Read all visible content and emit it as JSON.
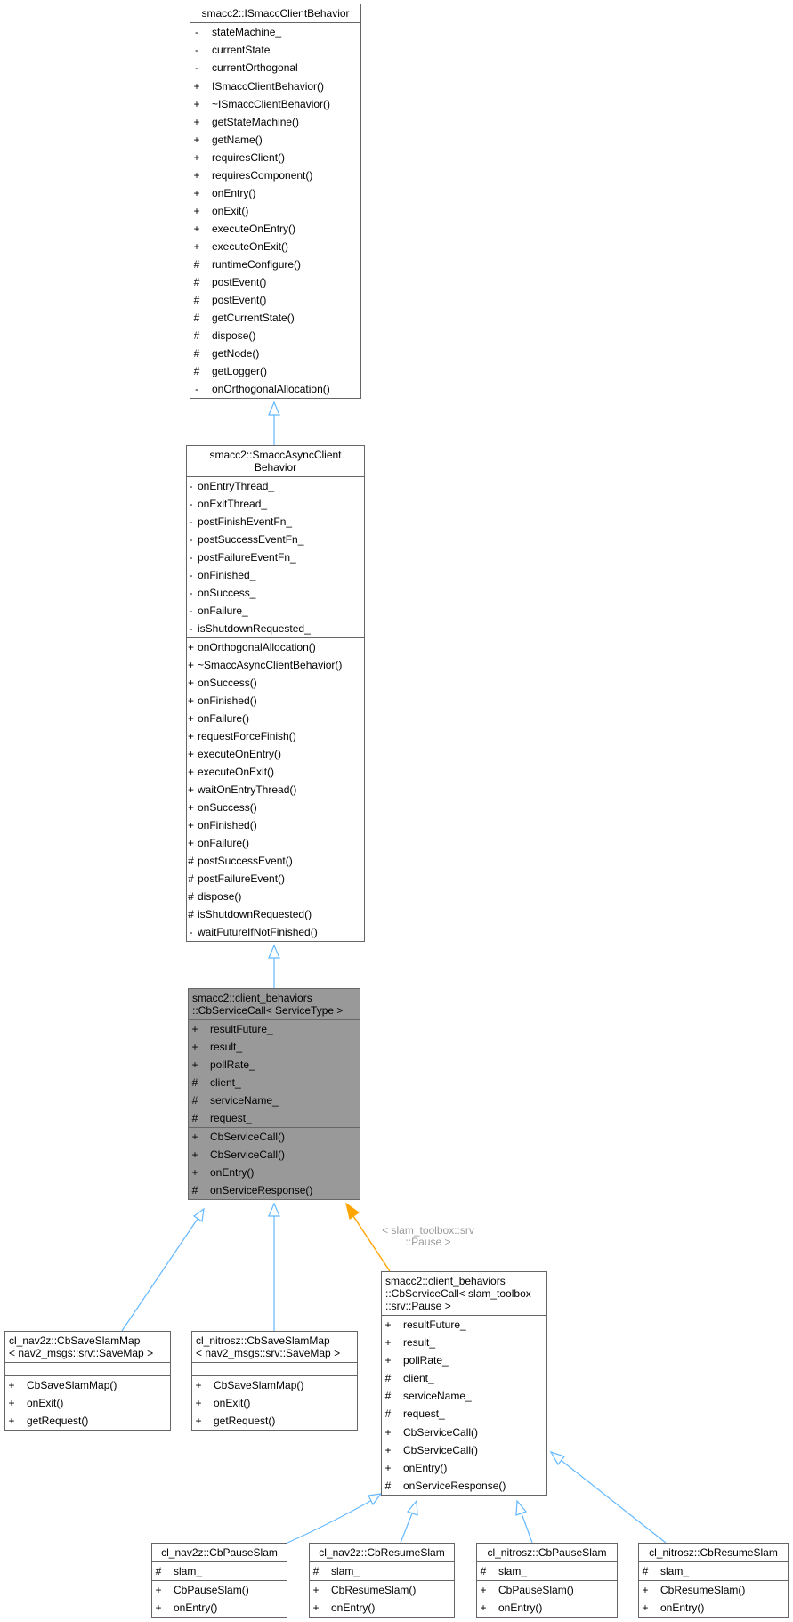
{
  "colors": {
    "inherit_edge": "#63b8ff",
    "template_edge": "#ffa500",
    "focus_fill": "#999999",
    "border": "#666666"
  },
  "template_edge_label": [
    "< slam_toolbox::srv",
    "::Pause >"
  ],
  "classes": {
    "isc": {
      "title": [
        "smacc2::ISmaccClientBehavior"
      ],
      "attributes": [
        {
          "v": "-",
          "n": "stateMachine_"
        },
        {
          "v": "-",
          "n": "currentState"
        },
        {
          "v": "-",
          "n": "currentOrthogonal"
        }
      ],
      "methods": [
        {
          "v": "+",
          "n": "ISmaccClientBehavior()"
        },
        {
          "v": "+",
          "n": "~ISmaccClientBehavior()"
        },
        {
          "v": "+",
          "n": "getStateMachine()"
        },
        {
          "v": "+",
          "n": "getName()"
        },
        {
          "v": "+",
          "n": "requiresClient()"
        },
        {
          "v": "+",
          "n": "requiresComponent()"
        },
        {
          "v": "+",
          "n": "onEntry()"
        },
        {
          "v": "+",
          "n": "onExit()"
        },
        {
          "v": "+",
          "n": "executeOnEntry()"
        },
        {
          "v": "+",
          "n": "executeOnExit()"
        },
        {
          "v": "#",
          "n": "runtimeConfigure()"
        },
        {
          "v": "#",
          "n": "postEvent()"
        },
        {
          "v": "#",
          "n": "postEvent()"
        },
        {
          "v": "#",
          "n": "getCurrentState()"
        },
        {
          "v": "#",
          "n": "dispose()"
        },
        {
          "v": "#",
          "n": "getNode()"
        },
        {
          "v": "#",
          "n": "getLogger()"
        },
        {
          "v": "-",
          "n": "onOrthogonalAllocation()"
        }
      ]
    },
    "sacb": {
      "title": [
        "smacc2::SmaccAsyncClient",
        "Behavior"
      ],
      "attributes": [
        {
          "v": "-",
          "n": "onEntryThread_"
        },
        {
          "v": "-",
          "n": "onExitThread_"
        },
        {
          "v": "-",
          "n": "postFinishEventFn_"
        },
        {
          "v": "-",
          "n": "postSuccessEventFn_"
        },
        {
          "v": "-",
          "n": "postFailureEventFn_"
        },
        {
          "v": "-",
          "n": "onFinished_"
        },
        {
          "v": "-",
          "n": "onSuccess_"
        },
        {
          "v": "-",
          "n": "onFailure_"
        },
        {
          "v": "-",
          "n": "isShutdownRequested_"
        }
      ],
      "methods": [
        {
          "v": "+",
          "n": "onOrthogonalAllocation()"
        },
        {
          "v": "+",
          "n": "~SmaccAsyncClientBehavior()"
        },
        {
          "v": "+",
          "n": "onSuccess()"
        },
        {
          "v": "+",
          "n": "onFinished()"
        },
        {
          "v": "+",
          "n": "onFailure()"
        },
        {
          "v": "+",
          "n": "requestForceFinish()"
        },
        {
          "v": "+",
          "n": "executeOnEntry()"
        },
        {
          "v": "+",
          "n": "executeOnExit()"
        },
        {
          "v": "+",
          "n": "waitOnEntryThread()"
        },
        {
          "v": "+",
          "n": "onSuccess()"
        },
        {
          "v": "+",
          "n": "onFinished()"
        },
        {
          "v": "+",
          "n": "onFailure()"
        },
        {
          "v": "#",
          "n": "postSuccessEvent()"
        },
        {
          "v": "#",
          "n": "postFailureEvent()"
        },
        {
          "v": "#",
          "n": "dispose()"
        },
        {
          "v": "#",
          "n": "isShutdownRequested()"
        },
        {
          "v": "-",
          "n": "waitFutureIfNotFinished()"
        }
      ]
    },
    "cbsc": {
      "title": [
        "smacc2::client_behaviors",
        "::CbServiceCall< ServiceType >"
      ],
      "attributes": [
        {
          "v": "+",
          "n": "resultFuture_"
        },
        {
          "v": "+",
          "n": "result_"
        },
        {
          "v": "+",
          "n": "pollRate_"
        },
        {
          "v": "#",
          "n": "client_"
        },
        {
          "v": "#",
          "n": "serviceName_"
        },
        {
          "v": "#",
          "n": "request_"
        }
      ],
      "methods": [
        {
          "v": "+",
          "n": "CbServiceCall()"
        },
        {
          "v": "+",
          "n": "CbServiceCall()"
        },
        {
          "v": "+",
          "n": "onEntry()"
        },
        {
          "v": "#",
          "n": "onServiceResponse()"
        }
      ]
    },
    "nav2save": {
      "title": [
        "cl_nav2z::CbSaveSlamMap",
        "< nav2_msgs::srv::SaveMap >"
      ],
      "attributes": [],
      "methods": [
        {
          "v": "+",
          "n": "CbSaveSlamMap()"
        },
        {
          "v": "+",
          "n": "onExit()"
        },
        {
          "v": "+",
          "n": "getRequest()"
        }
      ]
    },
    "nitrosave": {
      "title": [
        "cl_nitrosz::CbSaveSlamMap",
        "< nav2_msgs::srv::SaveMap >"
      ],
      "attributes": [],
      "methods": [
        {
          "v": "+",
          "n": "CbSaveSlamMap()"
        },
        {
          "v": "+",
          "n": "onExit()"
        },
        {
          "v": "+",
          "n": "getRequest()"
        }
      ]
    },
    "cbscpause": {
      "title": [
        "smacc2::client_behaviors",
        "::CbServiceCall< slam_toolbox",
        "::srv::Pause >"
      ],
      "attributes": [
        {
          "v": "+",
          "n": "resultFuture_"
        },
        {
          "v": "+",
          "n": "result_"
        },
        {
          "v": "+",
          "n": "pollRate_"
        },
        {
          "v": "#",
          "n": "client_"
        },
        {
          "v": "#",
          "n": "serviceName_"
        },
        {
          "v": "#",
          "n": "request_"
        }
      ],
      "methods": [
        {
          "v": "+",
          "n": "CbServiceCall()"
        },
        {
          "v": "+",
          "n": "CbServiceCall()"
        },
        {
          "v": "+",
          "n": "onEntry()"
        },
        {
          "v": "#",
          "n": "onServiceResponse()"
        }
      ]
    },
    "nav2pause": {
      "title": [
        "cl_nav2z::CbPauseSlam"
      ],
      "attributes": [
        {
          "v": "#",
          "n": "slam_"
        }
      ],
      "methods": [
        {
          "v": "+",
          "n": "CbPauseSlam()"
        },
        {
          "v": "+",
          "n": "onEntry()"
        }
      ]
    },
    "nav2resume": {
      "title": [
        "cl_nav2z::CbResumeSlam"
      ],
      "attributes": [
        {
          "v": "#",
          "n": "slam_"
        }
      ],
      "methods": [
        {
          "v": "+",
          "n": "CbResumeSlam()"
        },
        {
          "v": "+",
          "n": "onEntry()"
        }
      ]
    },
    "nitropause": {
      "title": [
        "cl_nitrosz::CbPauseSlam"
      ],
      "attributes": [
        {
          "v": "#",
          "n": "slam_"
        }
      ],
      "methods": [
        {
          "v": "+",
          "n": "CbPauseSlam()"
        },
        {
          "v": "+",
          "n": "onEntry()"
        }
      ]
    },
    "nitroresume": {
      "title": [
        "cl_nitrosz::CbResumeSlam"
      ],
      "attributes": [
        {
          "v": "#",
          "n": "slam_"
        }
      ],
      "methods": [
        {
          "v": "+",
          "n": "CbResumeSlam()"
        },
        {
          "v": "+",
          "n": "onEntry()"
        }
      ]
    }
  }
}
